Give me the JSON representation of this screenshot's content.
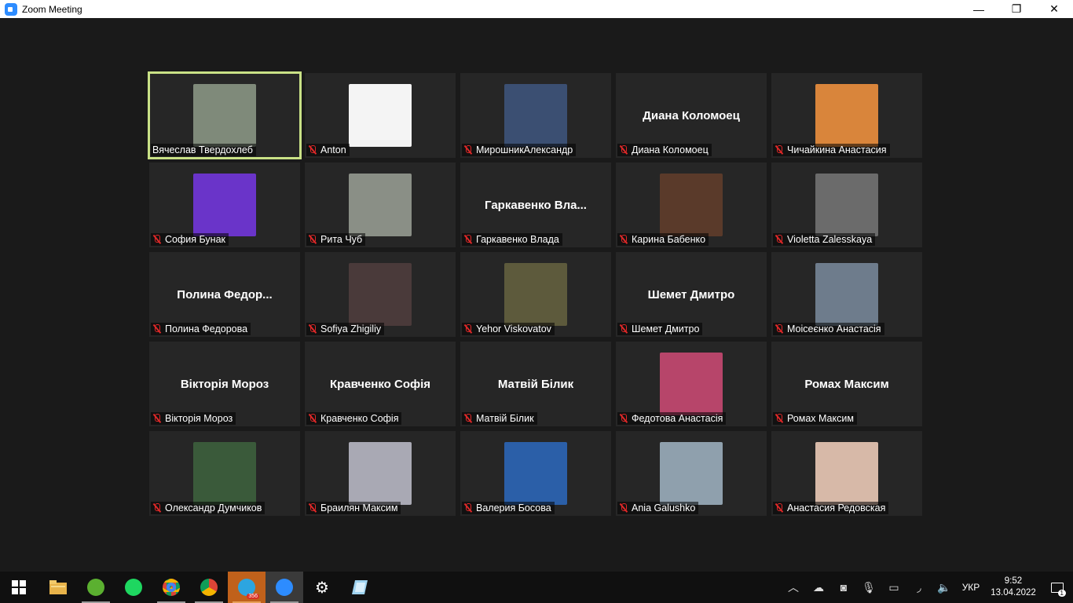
{
  "window": {
    "title": "Zoom Meeting",
    "minimize": "—",
    "maximize": "❐",
    "close": "✕"
  },
  "participants": [
    {
      "name": "Вячеслав Твердохлеб",
      "muted": false,
      "active": true,
      "photo": "#7f8a7a"
    },
    {
      "name": "Anton",
      "muted": true,
      "photo": "#f4f4f4"
    },
    {
      "name": "МирошникАлександр",
      "muted": true,
      "photo": "#3b4f72"
    },
    {
      "name": "Диана Коломоец",
      "muted": true,
      "display": "Диана Коломоец"
    },
    {
      "name": "Чичайкина Анастасия",
      "muted": true,
      "photo": "#d9853b"
    },
    {
      "name": "София Бунак",
      "muted": true,
      "photo": "#6a34c9"
    },
    {
      "name": "Рита Чуб",
      "muted": true,
      "photo": "#8a8f86"
    },
    {
      "name": "Гаркавенко Влада",
      "muted": true,
      "display": "Гаркавенко  Вла..."
    },
    {
      "name": "Карина Бабенко",
      "muted": true,
      "photo": "#5a3a2a"
    },
    {
      "name": "Violetta Zalesskaya",
      "muted": true,
      "photo": "#6b6b6b"
    },
    {
      "name": "Полина Федорова",
      "muted": true,
      "display": "Полина  Федор..."
    },
    {
      "name": "Sofiya Zhigiliy",
      "muted": true,
      "photo": "#4a3a3a"
    },
    {
      "name": "Yehor Viskovatov",
      "muted": true,
      "photo": "#5d5a3c"
    },
    {
      "name": "Шемет Дмитро",
      "muted": true,
      "display": "Шемет Дмитро"
    },
    {
      "name": "Моісеєнко Анастасія",
      "muted": true,
      "photo": "#6e7c8c"
    },
    {
      "name": "Вікторія Мороз",
      "muted": true,
      "display": "Вікторія Мороз"
    },
    {
      "name": "Кравченко Софія",
      "muted": true,
      "display": "Кравченко Софія"
    },
    {
      "name": "Матвій Білик",
      "muted": true,
      "display": "Матвій Білик"
    },
    {
      "name": "Федотова Анастасія",
      "muted": true,
      "photo": "#b7456a"
    },
    {
      "name": "Ромах Максим",
      "muted": true,
      "display": "Ромах Максим"
    },
    {
      "name": "Олександр Думчиков",
      "muted": true,
      "photo": "#3a5a3a"
    },
    {
      "name": "Браилян Максим",
      "muted": true,
      "photo": "#a9a9b4"
    },
    {
      "name": "Валерия Босова",
      "muted": true,
      "photo": "#2b5fa8"
    },
    {
      "name": "Ania Galushko",
      "muted": true,
      "photo": "#8fa0ad"
    },
    {
      "name": "Анастасия Редовская",
      "muted": true,
      "photo": "#d7b9a8"
    }
  ],
  "taskbar": {
    "apps": [
      {
        "icon": "windows-start-icon"
      },
      {
        "icon": "file-explorer-icon"
      },
      {
        "icon": "utorrent-icon"
      },
      {
        "icon": "spotify-icon"
      },
      {
        "icon": "chrome-icon"
      },
      {
        "icon": "chrome-profile-icon"
      },
      {
        "icon": "telegram-icon",
        "badge": "356"
      },
      {
        "icon": "zoom-icon"
      },
      {
        "icon": "settings-icon"
      },
      {
        "icon": "notepad-icon"
      }
    ],
    "lang": "УКР",
    "time": "9:52",
    "date": "13.04.2022",
    "notifications": "1"
  }
}
